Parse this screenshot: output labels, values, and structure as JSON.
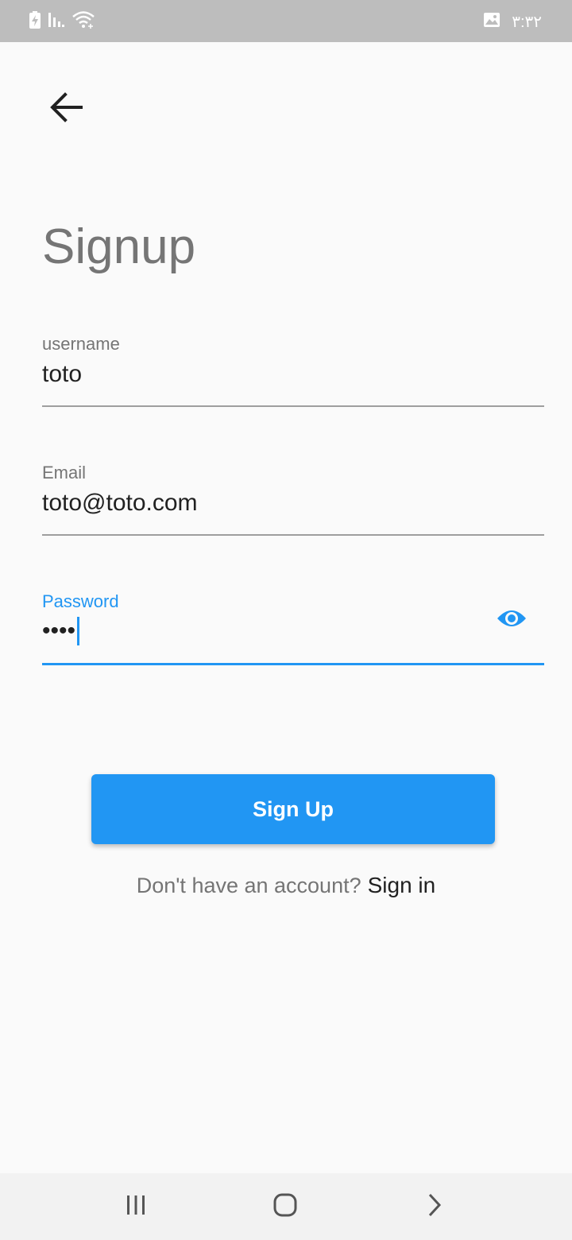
{
  "status_bar": {
    "time": "۳:۳۲",
    "icons": [
      "battery-charging-icon",
      "signal-icon",
      "wifi-icon",
      "gallery-notification-icon"
    ]
  },
  "header": {
    "back_icon": "arrow-left-icon"
  },
  "page": {
    "title": "Signup"
  },
  "form": {
    "username": {
      "label": "username",
      "value": "toto"
    },
    "email": {
      "label": "Email",
      "value": "toto@toto.com"
    },
    "password": {
      "label": "Password",
      "masked_value": "••••",
      "toggle_icon": "eye-icon",
      "focused": true
    }
  },
  "actions": {
    "signup_label": "Sign Up",
    "alt_prompt": "Don't have an account?",
    "alt_link": "Sign in"
  },
  "nav_bar": {
    "icons": [
      "recent-apps-icon",
      "home-icon",
      "back-chevron-icon"
    ]
  },
  "colors": {
    "accent": "#2196f3",
    "title": "#757575",
    "text": "#212121",
    "background": "#fafafa",
    "status_bar": "#bdbdbd"
  }
}
